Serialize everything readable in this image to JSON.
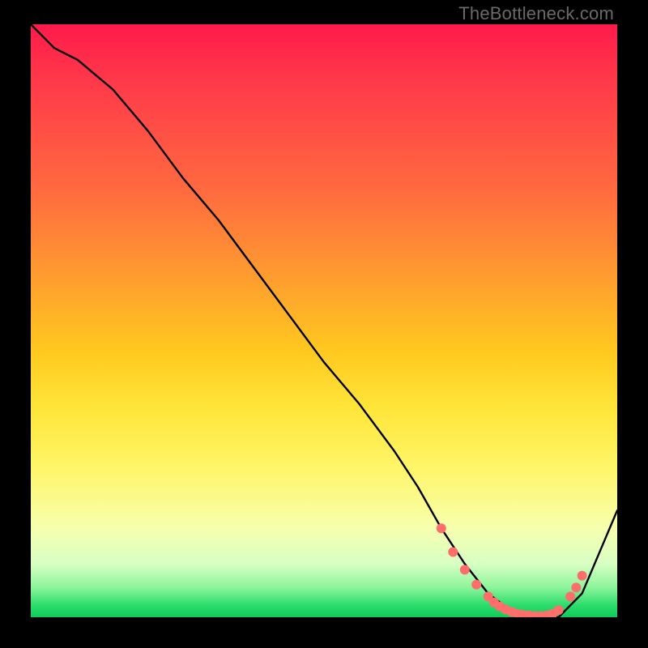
{
  "attribution": "TheBottleneck.com",
  "chart_data": {
    "type": "line",
    "title": "",
    "xlabel": "",
    "ylabel": "",
    "xlim": [
      0,
      100
    ],
    "ylim": [
      0,
      100
    ],
    "grid": false,
    "legend": false,
    "series": [
      {
        "name": "curve",
        "color": "#000000",
        "x": [
          0,
          4,
          8,
          14,
          20,
          26,
          32,
          38,
          44,
          50,
          56,
          62,
          66,
          70,
          74,
          78,
          82,
          86,
          90,
          94,
          100
        ],
        "y": [
          100,
          96,
          94,
          89,
          82,
          74,
          67,
          59,
          51,
          43,
          36,
          28,
          22,
          15,
          9,
          4,
          1,
          0,
          0,
          4,
          18
        ]
      }
    ],
    "markers": {
      "name": "dots",
      "color": "#ff6d6d",
      "radius_px": 6,
      "x": [
        70,
        72,
        74,
        76,
        78,
        79,
        80,
        81,
        82,
        83,
        84,
        85,
        86,
        87,
        88,
        89,
        90,
        92,
        93,
        94
      ],
      "y": [
        15,
        11,
        8,
        5.5,
        3.5,
        2.5,
        1.8,
        1.3,
        0.9,
        0.6,
        0.4,
        0.3,
        0.2,
        0.2,
        0.3,
        0.6,
        1.2,
        3.5,
        5,
        7
      ]
    }
  }
}
